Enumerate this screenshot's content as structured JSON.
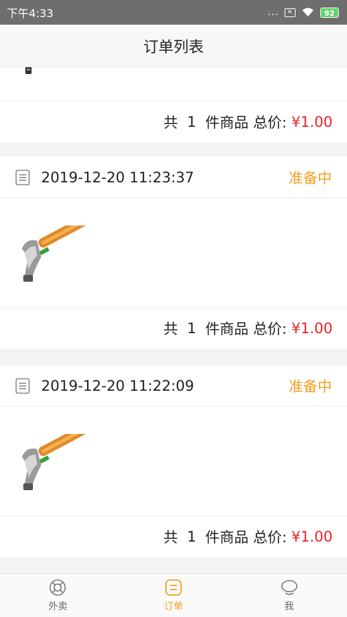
{
  "status_bar": {
    "time": "下午4:33",
    "battery": "92",
    "dots": "..."
  },
  "header": {
    "title": "订单列表"
  },
  "orders": [
    {
      "total_prefix": "共",
      "count": "1",
      "total_mid": "件商品 总价:",
      "price": "¥1.00"
    },
    {
      "time": "2019-12-20 11:23:37",
      "status": "准备中",
      "total_prefix": "共",
      "count": "1",
      "total_mid": "件商品 总价:",
      "price": "¥1.00"
    },
    {
      "time": "2019-12-20 11:22:09",
      "status": "准备中",
      "total_prefix": "共",
      "count": "1",
      "total_mid": "件商品 总价:",
      "price": "¥1.00"
    }
  ],
  "tabs": [
    {
      "label": "外卖",
      "icon": "takeout-icon"
    },
    {
      "label": "订单",
      "icon": "order-icon",
      "active": true
    },
    {
      "label": "我",
      "icon": "profile-icon"
    }
  ],
  "colors": {
    "accent": "#f2a020",
    "price": "#e8242a",
    "status_bar": "#6e6e6e"
  }
}
